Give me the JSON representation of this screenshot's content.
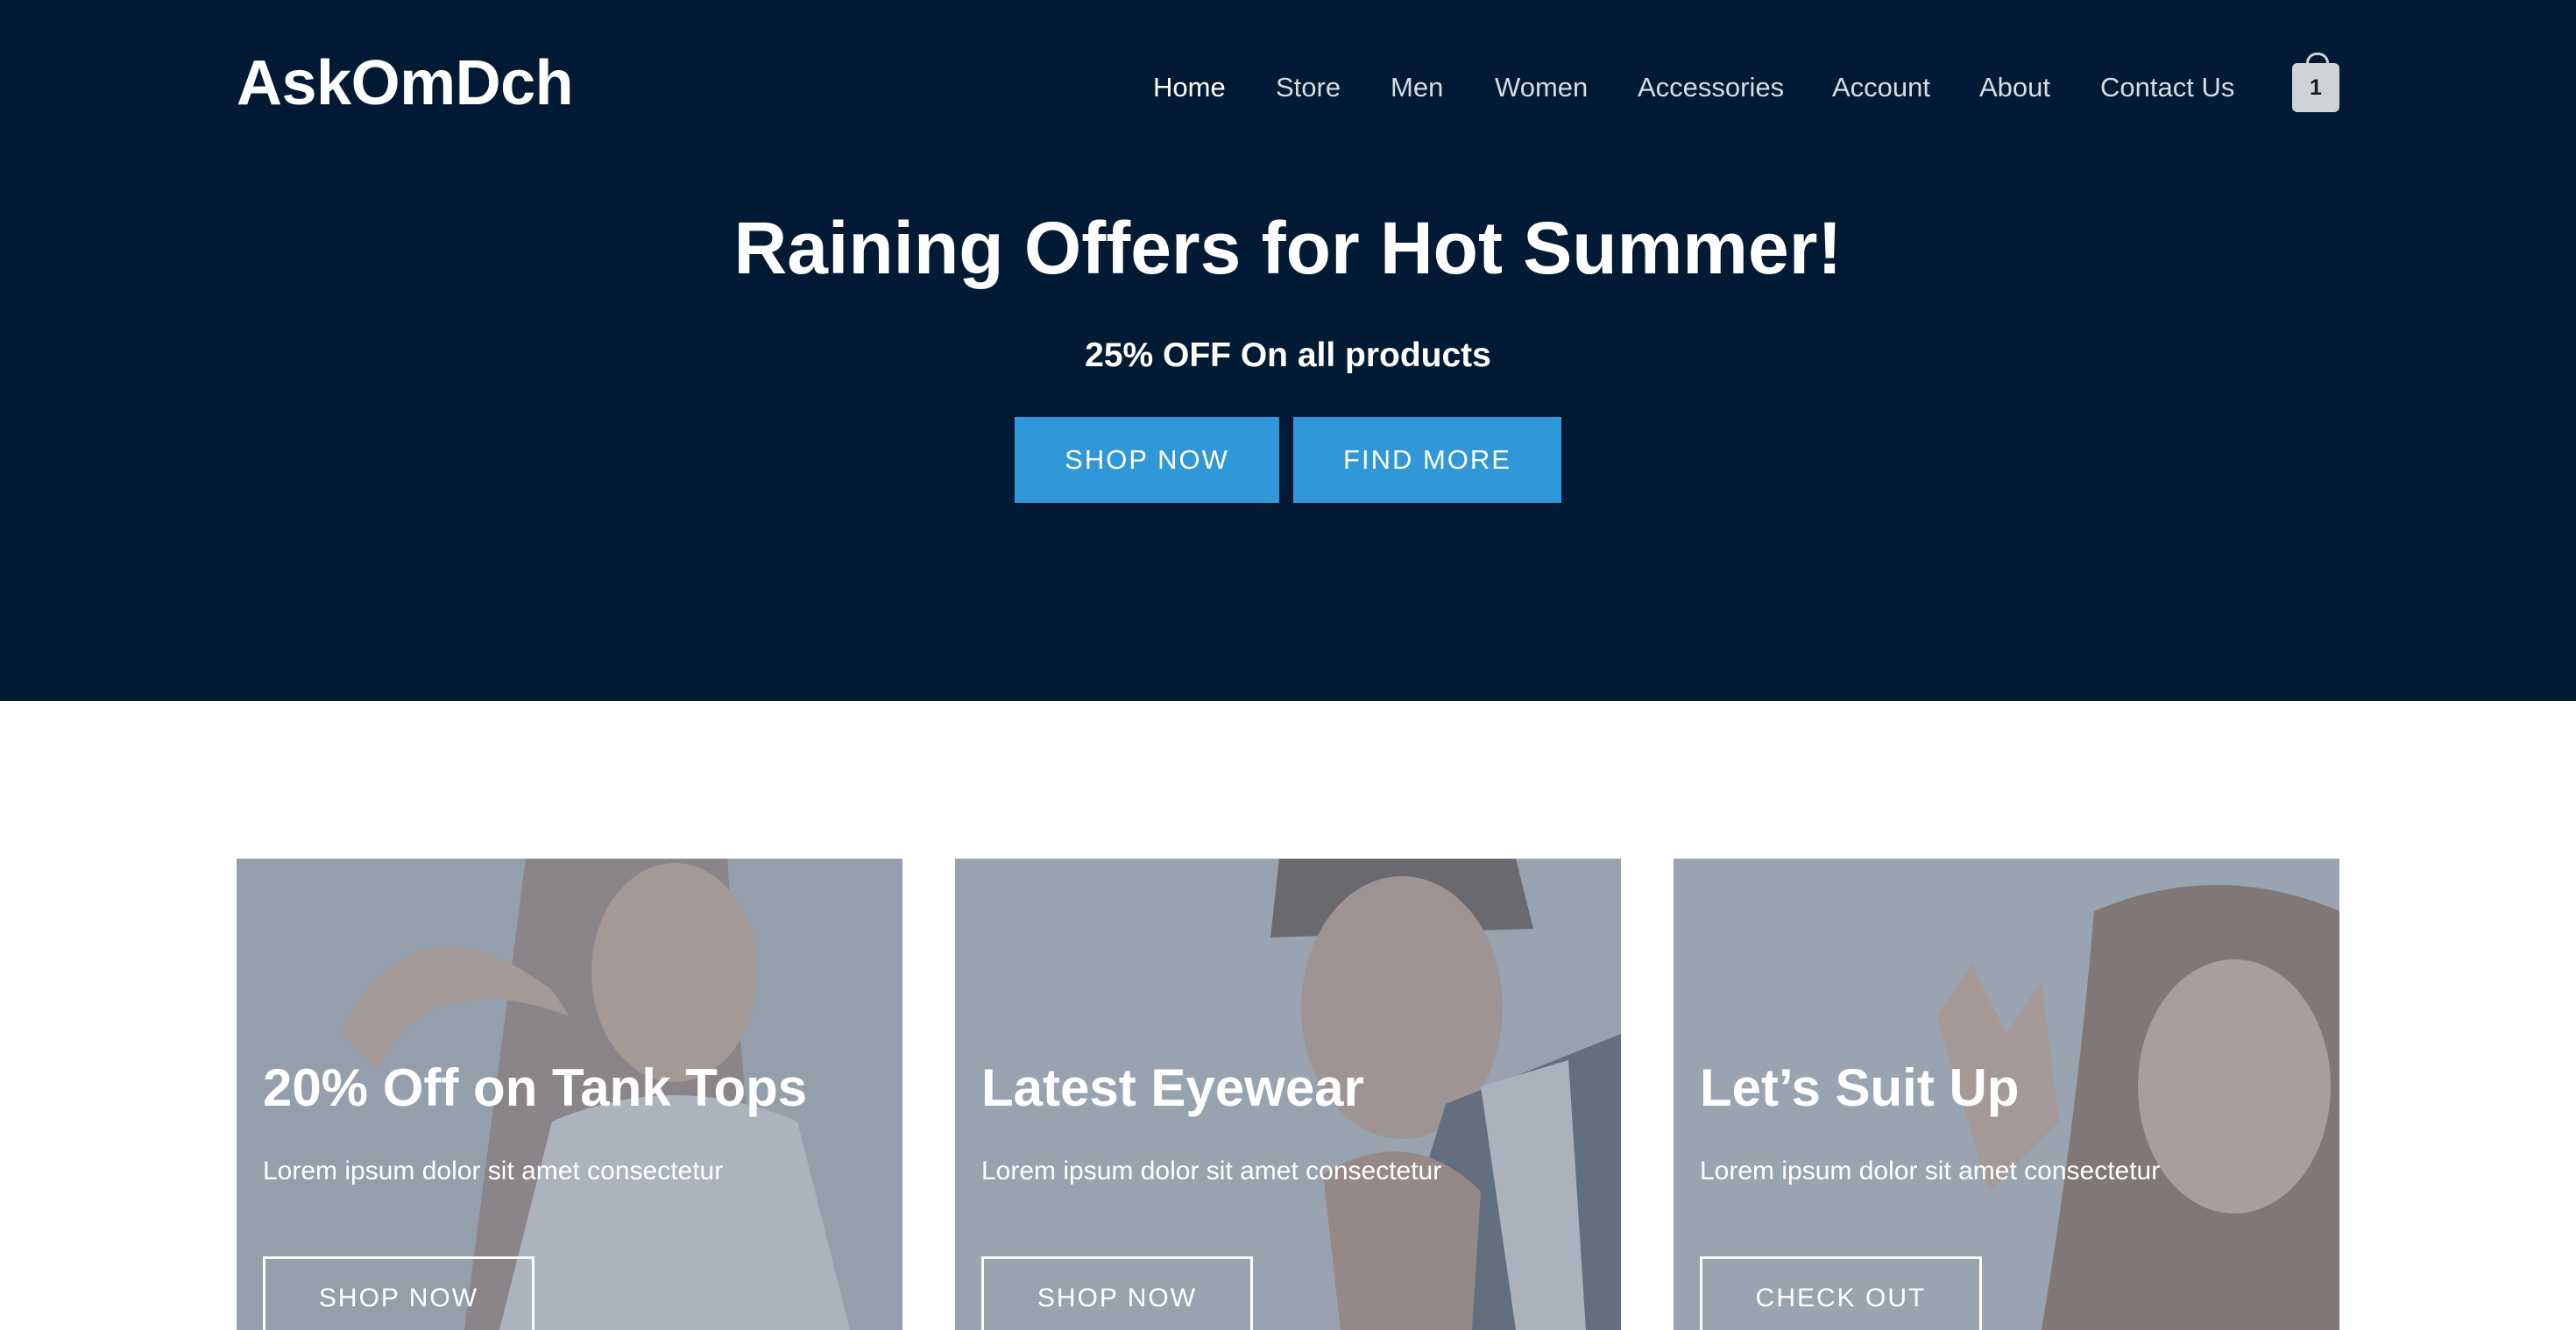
{
  "brand": {
    "logo": "AskOmDch"
  },
  "nav": {
    "items": [
      {
        "label": "Home",
        "active": true
      },
      {
        "label": "Store"
      },
      {
        "label": "Men"
      },
      {
        "label": "Women"
      },
      {
        "label": "Accessories"
      },
      {
        "label": "Account"
      },
      {
        "label": "About"
      },
      {
        "label": "Contact Us"
      }
    ],
    "cart_count": "1"
  },
  "hero": {
    "title": "Raining Offers for Hot Summer!",
    "subtitle": "25% OFF On all products",
    "buttons": [
      "SHOP NOW",
      "FIND MORE"
    ]
  },
  "promos": [
    {
      "title": "20% Off on Tank Tops",
      "text": "Lorem ipsum dolor sit amet consectetur",
      "button": "SHOP NOW"
    },
    {
      "title": "Latest Eyewear",
      "text": "Lorem ipsum dolor sit amet consectetur",
      "button": "SHOP NOW"
    },
    {
      "title": "Let’s Suit Up",
      "text": "Lorem ipsum dolor sit amet consectetur",
      "button": "CHECK OUT"
    }
  ],
  "colors": {
    "hero_bg": "#021a33",
    "accent": "#3097d9",
    "cart_bg": "#cfd3d8"
  },
  "icons": {
    "cart": "shopping-bag-icon"
  }
}
